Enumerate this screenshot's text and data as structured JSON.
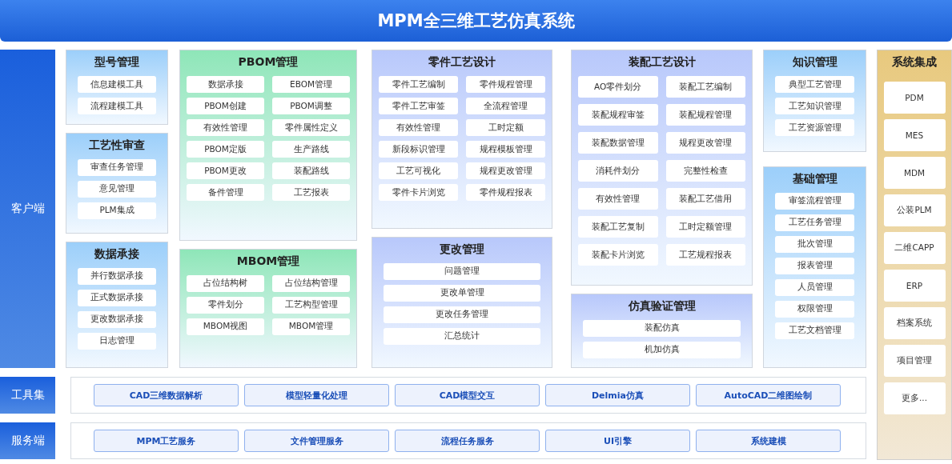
{
  "header": {
    "title": "MPM全三维工艺仿真系统"
  },
  "client": {
    "label": "客户端",
    "columns": [
      [
        {
          "title": "型号管理",
          "color": "#9ccffa",
          "kind": "single",
          "items": [
            "信息建模工具",
            "流程建模工具"
          ]
        },
        {
          "title": "工艺性审查",
          "color": "#9ccffa",
          "kind": "single",
          "items": [
            "审查任务管理",
            "意见管理",
            "PLM集成"
          ]
        },
        {
          "title": "数据承接",
          "color": "#9ccffa",
          "kind": "single",
          "items": [
            "并行数据承接",
            "正式数据承接",
            "更改数据承接",
            "日志管理"
          ]
        }
      ],
      [
        {
          "title": "PBOM管理",
          "color": "#8ee6b8",
          "kind": "double",
          "items": [
            "数据承接",
            "EBOM管理",
            "PBOM创建",
            "PBOM调整",
            "有效性管理",
            "零件属性定义",
            "PBOM定版",
            "生产路线",
            "PBOM更改",
            "装配路线",
            "备件管理",
            "工艺报表"
          ]
        },
        {
          "title": "MBOM管理",
          "color": "#8ee6b8",
          "kind": "double",
          "items": [
            "占位结构树",
            "占位结构管理",
            "零件划分",
            "工艺构型管理",
            "MBOM视图",
            "MBOM管理"
          ]
        }
      ],
      [
        {
          "title": "零件工艺设计",
          "color": "#b8c8fb",
          "kind": "double",
          "items": [
            "零件工艺编制",
            "零件规程管理",
            "零件工艺审签",
            "全流程管理",
            "有效性管理",
            "工时定额",
            "新段标识管理",
            "规程模板管理",
            "工艺可视化",
            "规程更改管理",
            "零件卡片浏览",
            "零件规程报表"
          ]
        },
        {
          "title": "更改管理",
          "color": "#b8c8fb",
          "kind": "single",
          "items": [
            "问题管理",
            "更改单管理",
            "更改任务管理",
            "汇总统计"
          ]
        }
      ],
      [
        {
          "title": "装配工艺设计",
          "color": "#b8c8fb",
          "kind": "double",
          "items": [
            "AO零件划分",
            "装配工艺编制",
            "装配规程审签",
            "装配规程管理",
            "装配数据管理",
            "规程更改管理",
            "消耗件划分",
            "完整性检查",
            "有效性管理",
            "装配工艺借用",
            "装配工艺复制",
            "工时定额管理",
            "装配卡片浏览",
            "工艺规程报表"
          ]
        },
        {
          "title": "仿真验证管理",
          "color": "#b8c8fb",
          "kind": "single",
          "items": [
            "装配仿真",
            "机加仿真"
          ]
        }
      ],
      [
        {
          "title": "知识管理",
          "color": "#9ccffa",
          "kind": "single",
          "items": [
            "典型工艺管理",
            "工艺知识管理",
            "工艺资源管理"
          ]
        },
        {
          "title": "基础管理",
          "color": "#9ccffa",
          "kind": "single",
          "items": [
            "审签流程管理",
            "工艺任务管理",
            "批次管理",
            "报表管理",
            "人员管理",
            "权限管理",
            "工艺文档管理"
          ]
        }
      ]
    ]
  },
  "tools": {
    "label": "工具集",
    "items": [
      "CAD三维数据解析",
      "模型轻量化处理",
      "CAD模型交互",
      "Delmia仿真",
      "AutoCAD二维图绘制"
    ]
  },
  "services": {
    "label": "服务端",
    "items": [
      "MPM工艺服务",
      "文件管理服务",
      "流程任务服务",
      "UI引擎",
      "系统建模"
    ]
  },
  "integration": {
    "title": "系统集成",
    "items": [
      "PDM",
      "MES",
      "MDM",
      "公装PLM",
      "二维CAPP",
      "ERP",
      "档案系统",
      "项目管理",
      "更多..."
    ]
  }
}
